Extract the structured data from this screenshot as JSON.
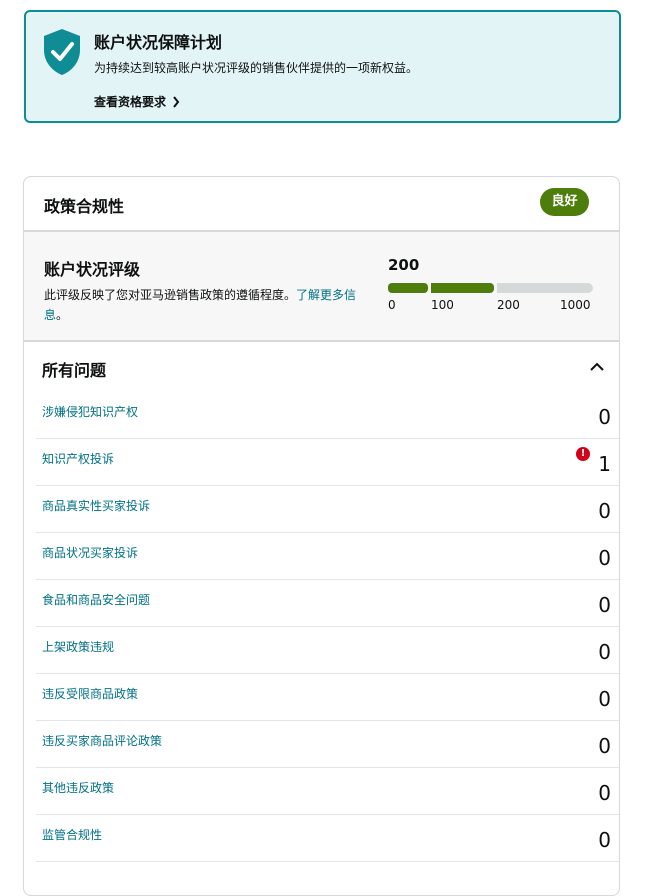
{
  "banner": {
    "title": "账户状况保障计划",
    "description": "为持续达到较高账户状况评级的销售伙伴提供的一项新权益。",
    "link": "查看资格要求",
    "accent_color": "#0f8c94",
    "icon": "shield-check-icon"
  },
  "policy": {
    "title": "政策合规性",
    "badge": "良好",
    "badge_color": "#4f7d0b"
  },
  "rating": {
    "title": "账户状况评级",
    "description": "此评级反映了您对亚马逊销售政策的遵循程度。",
    "link": "了解更多信息",
    "link_suffix": "。",
    "score": "200",
    "ticks": [
      "0",
      "100",
      "200",
      "1000"
    ]
  },
  "issues": {
    "title": "所有问题",
    "items": [
      {
        "label": "涉嫌侵犯知识产权",
        "count": "0"
      },
      {
        "label": "知识产权投诉",
        "count": "1",
        "alert": "!"
      },
      {
        "label": "商品真实性买家投诉",
        "count": "0"
      },
      {
        "label": "商品状况买家投诉",
        "count": "0"
      },
      {
        "label": "食品和商品安全问题",
        "count": "0"
      },
      {
        "label": "上架政策违规",
        "count": "0"
      },
      {
        "label": "违反受限商品政策",
        "count": "0"
      },
      {
        "label": "违反买家商品评论政策",
        "count": "0"
      },
      {
        "label": "其他违反政策",
        "count": "0"
      },
      {
        "label": "监管合规性",
        "count": "0"
      }
    ]
  }
}
